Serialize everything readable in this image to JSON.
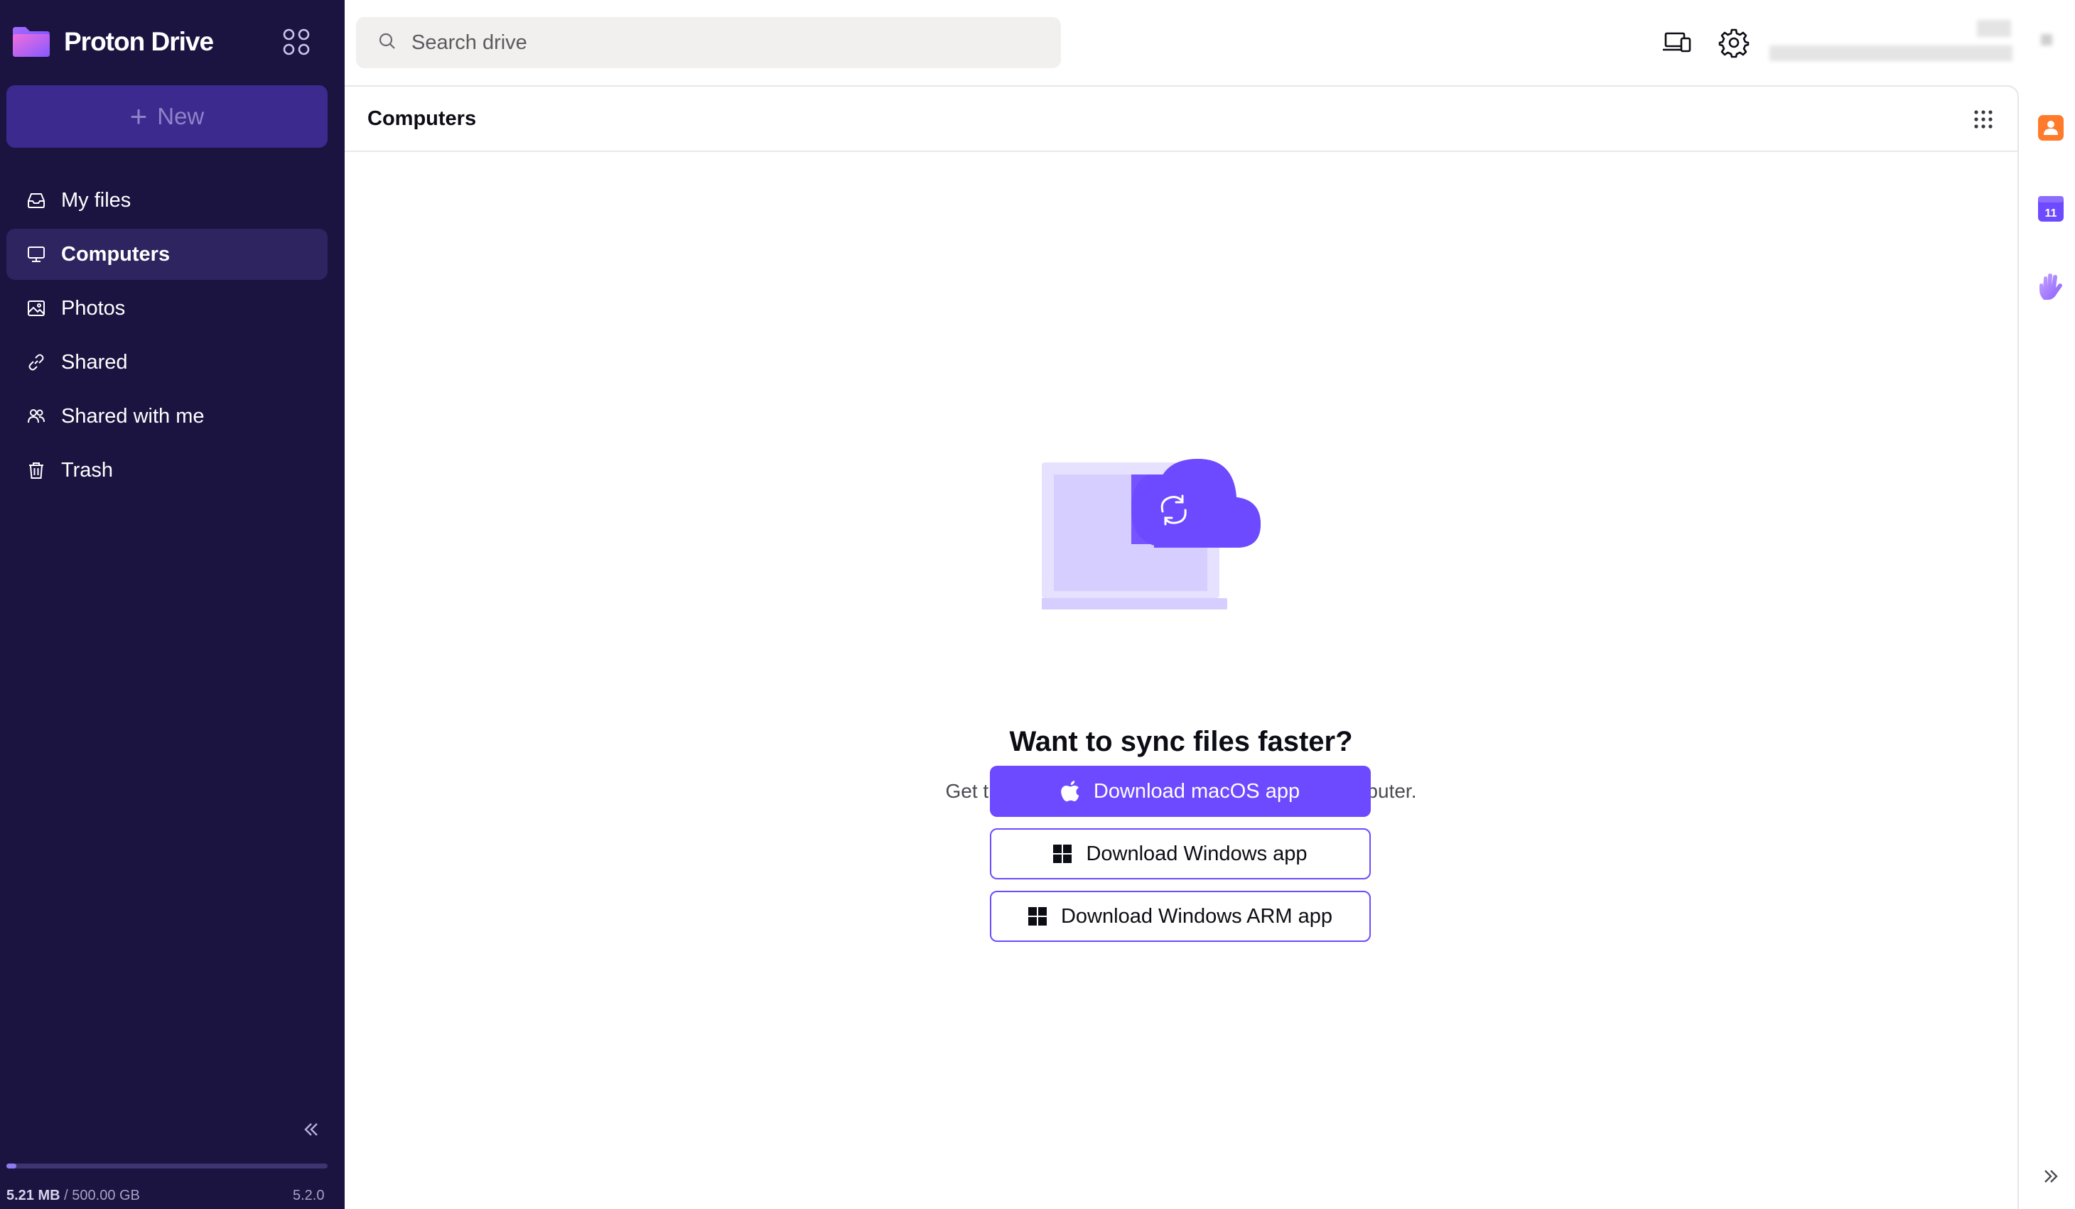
{
  "app": {
    "name": "Proton Drive",
    "brand_color": "#6d4aff",
    "sidebar_color": "#1b1340"
  },
  "sidebar": {
    "new_label": "New",
    "items": [
      {
        "label": "My files",
        "icon": "inbox-icon",
        "active": false
      },
      {
        "label": "Computers",
        "icon": "monitor-icon",
        "active": true
      },
      {
        "label": "Photos",
        "icon": "image-icon",
        "active": false
      },
      {
        "label": "Shared",
        "icon": "link-icon",
        "active": false
      },
      {
        "label": "Shared with me",
        "icon": "users-icon",
        "active": false
      },
      {
        "label": "Trash",
        "icon": "trash-icon",
        "active": false
      }
    ],
    "storage": {
      "used": "5.21 MB",
      "separator": " / ",
      "total": "500.00 GB",
      "fraction": 0.0104
    },
    "version": "5.2.0"
  },
  "search": {
    "placeholder": "Search drive"
  },
  "main": {
    "title": "Computers",
    "empty_state": {
      "headline": "Want to sync files faster?",
      "subline": "Get the desktop app to sync files from your computer.",
      "buttons": {
        "mac": "Download macOS app",
        "windows": "Download Windows app",
        "windows_arm": "Download Windows ARM app"
      }
    }
  },
  "right_rail": {
    "calendar_day": "11"
  }
}
